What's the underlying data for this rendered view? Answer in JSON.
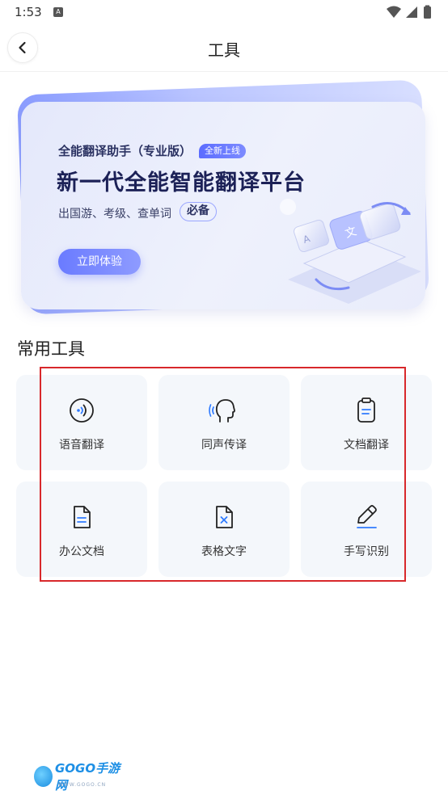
{
  "status_bar": {
    "time": "1:53",
    "notification_icon": "a-notification-icon",
    "icons": [
      "wifi-icon",
      "signal-icon",
      "battery-icon"
    ]
  },
  "header": {
    "title": "工具",
    "back_icon": "chevron-left-icon"
  },
  "banner": {
    "subtitle": "全能翻译助手（专业版）",
    "badge": "全新上线",
    "title": "新一代全能智能翻译平台",
    "desc": "出国游、考级、查单词",
    "must": "必备",
    "button": "立即体验",
    "colors": {
      "accent": "#6a7bff",
      "title": "#1c2157"
    }
  },
  "section": {
    "title": "常用工具"
  },
  "tools": [
    {
      "label": "语音翻译",
      "icon": "voice-translate-icon"
    },
    {
      "label": "同声传译",
      "icon": "simultaneous-interpretation-icon"
    },
    {
      "label": "文档翻译",
      "icon": "document-translate-icon"
    },
    {
      "label": "办公文档",
      "icon": "office-document-icon"
    },
    {
      "label": "表格文字",
      "icon": "table-text-icon"
    },
    {
      "label": "手写识别",
      "icon": "handwriting-recognition-icon"
    }
  ],
  "watermark": {
    "text": "GOGO手游网",
    "url": "WWW.GOGO.CN"
  }
}
